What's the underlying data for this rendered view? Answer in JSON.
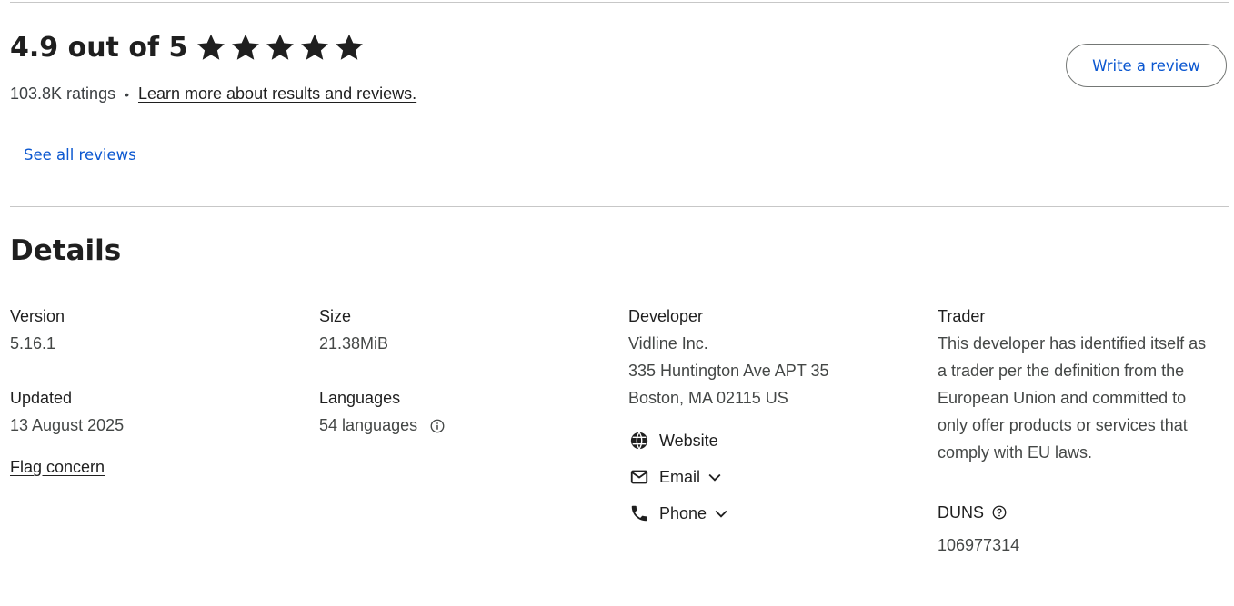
{
  "rating": {
    "title": "4.9 out of 5",
    "stars_value": 4.9,
    "stars_max": 5,
    "count_text": "103.8K ratings",
    "separator": "•",
    "learn_more_link": "Learn more about results and reviews.",
    "write_review_button": "Write a review",
    "see_all_reviews": "See all reviews"
  },
  "details": {
    "heading": "Details",
    "version": {
      "label": "Version",
      "value": "5.16.1"
    },
    "updated": {
      "label": "Updated",
      "value": "13 August 2025"
    },
    "flag_concern": "Flag concern",
    "size": {
      "label": "Size",
      "value": "21.38MiB"
    },
    "languages": {
      "label": "Languages",
      "value": "54 languages"
    },
    "developer": {
      "label": "Developer",
      "name": "Vidline Inc.",
      "address_line1": "335 Huntington Ave APT 35",
      "address_line2": "Boston, MA 02115 US",
      "website": "Website",
      "email": "Email",
      "phone": "Phone"
    },
    "trader": {
      "label": "Trader",
      "text": "This developer has identified itself as a trader per the definition from the European Union and committed to only offer products or services that comply with EU laws."
    },
    "duns": {
      "label": "DUNS",
      "value": "106977314"
    }
  },
  "colors": {
    "accent_link": "#0b57d0",
    "text_primary": "#1f1f1f",
    "text_secondary": "#444746",
    "divider": "#c7c7c7"
  }
}
